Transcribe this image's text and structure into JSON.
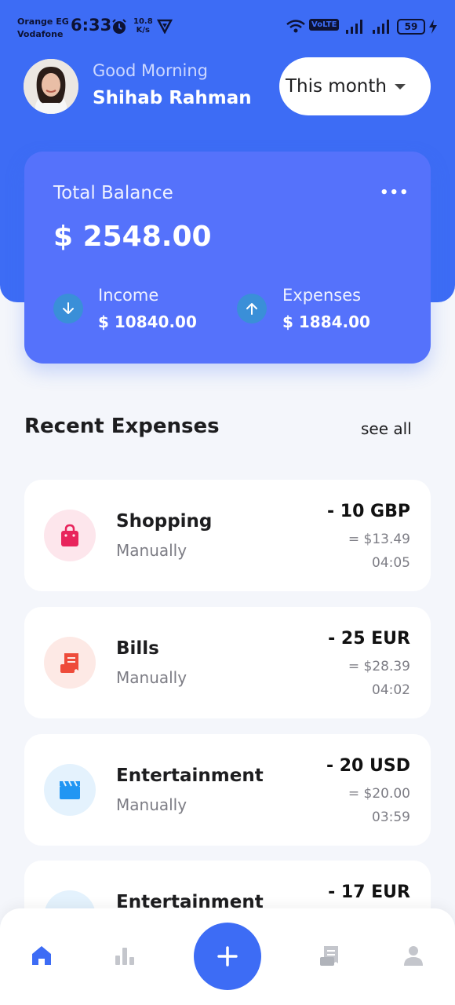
{
  "status_bar": {
    "carrier_1": "Orange EG",
    "carrier_2": "Vodafone",
    "time": "6:33",
    "net_speed_value": "10.8",
    "net_speed_unit": "K/s",
    "volte": "VoLTE",
    "battery": "59"
  },
  "header": {
    "greeting": "Good Morning",
    "user_name": "Shihab Rahman",
    "period_label": "This month"
  },
  "balance": {
    "label": "Total Balance",
    "value": "$ 2548.00",
    "income_label": "Income",
    "income_value": "$ 10840.00",
    "expenses_label": "Expenses",
    "expenses_value": "$ 1884.00"
  },
  "recent": {
    "title": "Recent Expenses",
    "see_all": "see all",
    "items": [
      {
        "title": "Shopping",
        "method": "Manually",
        "amount": "- 10 GBP",
        "converted": "= $13.49",
        "time": "04:05",
        "icon": "shopping-bag-icon",
        "icon_color": "#e8245c",
        "icon_bg": "#fde6ec"
      },
      {
        "title": "Bills",
        "method": "Manually",
        "amount": "- 25 EUR",
        "converted": "= $28.39",
        "time": "04:02",
        "icon": "receipt-icon",
        "icon_color": "#ee4b3a",
        "icon_bg": "#fde9e5"
      },
      {
        "title": "Entertainment",
        "method": "Manually",
        "amount": "- 20 USD",
        "converted": "= $20.00",
        "time": "03:59",
        "icon": "clapperboard-icon",
        "icon_color": "#2196f3",
        "icon_bg": "#e4f2fd"
      },
      {
        "title": "Entertainment",
        "method": "",
        "amount": "- 17 EUR",
        "converted": "",
        "time": "",
        "icon": "clapperboard-icon",
        "icon_color": "#2196f3",
        "icon_bg": "#e4f2fd"
      }
    ]
  },
  "nav": {
    "items": [
      "home-icon",
      "chart-icon",
      "add-icon",
      "receipt-icon",
      "profile-icon"
    ],
    "active_color": "#3d6cf5",
    "inactive_color": "#c4c6cc"
  }
}
